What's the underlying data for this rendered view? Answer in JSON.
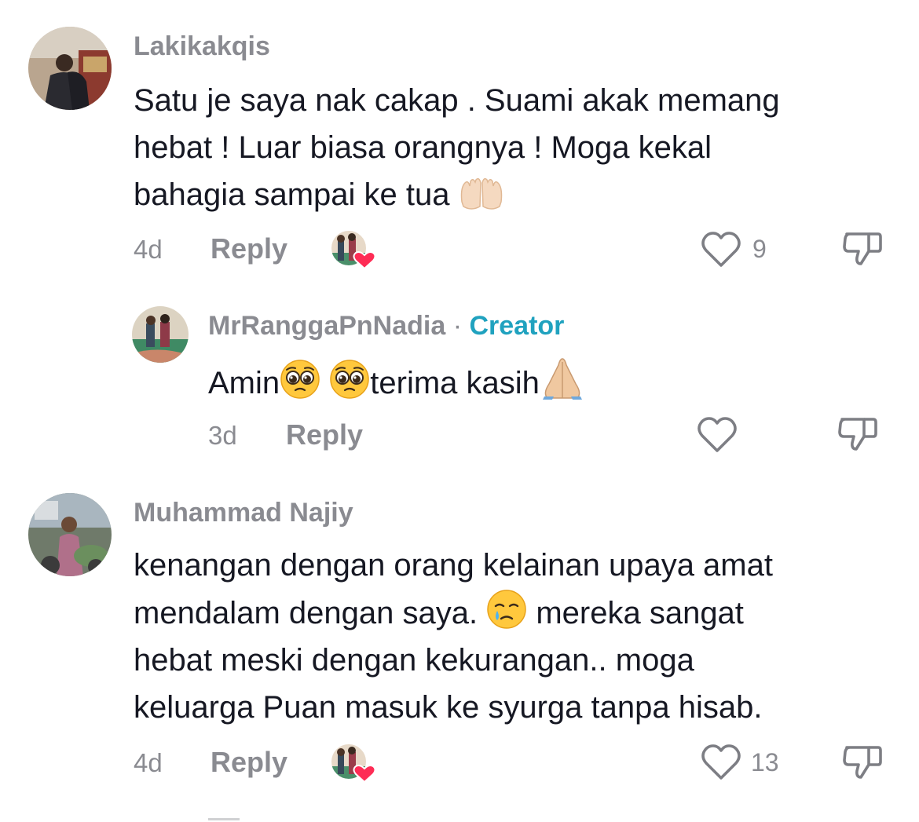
{
  "comments": [
    {
      "username": "Lakikakqis",
      "lines": [
        "Satu je saya nak cakap . Suami akak memang",
        "hebat ! Luar biasa orangnya ! Moga kekal",
        "bahagia sampai ke tua"
      ],
      "trailing_emoji": "raising-hands",
      "time": "4d",
      "reply_label": "Reply",
      "likes": "9"
    },
    {
      "username": "MrRanggaPnNadia",
      "separator": " · ",
      "badge": "Creator",
      "text_prefix": "Amin",
      "text_suffix": "terima kasih",
      "emojis": [
        "pleading-face",
        "pleading-face",
        "folded-hands"
      ],
      "time": "3d",
      "reply_label": "Reply"
    },
    {
      "username": "Muhammad Najiy",
      "lines": [
        "kenangan dengan orang kelainan upaya amat",
        "mendalam dengan saya.",
        "mereka sangat",
        "hebat meski dengan kekurangan.. moga",
        "keluarga Puan masuk ke syurga tanpa hisab."
      ],
      "inline_emoji": "crying-face",
      "time": "4d",
      "reply_label": "Reply",
      "likes": "13"
    }
  ],
  "icons": {
    "like": "heart-outline-icon",
    "dislike": "thumbs-down-icon",
    "creator_liked": "creator-liked-heart-icon"
  },
  "colors": {
    "text": "#161823",
    "muted": "#8a8b91",
    "creator": "#20a2bf",
    "heart": "#fe2c55"
  }
}
